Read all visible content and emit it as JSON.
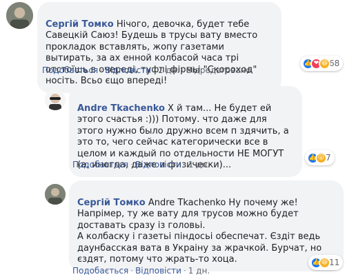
{
  "comments": [
    {
      "author": "Сергій Томко",
      "text": " Нічого, девочка, будет тебе Савецкій Саюз! Будешь в трусы вату вместо прокладок вставлять, жопу газетами вытирать, за ах        енной колбасой часа трі отстоїшь в очереді, туфлі фірмьі \"Скороход\" носіть. Всьо єщо впереді!",
      "actions": {
        "like": "Подобається",
        "reply": "Відповісти",
        "time": "1 дн.",
        "edited": "Відредаговано"
      },
      "reactions": {
        "icons": [
          "like-icon",
          "love-icon",
          "haha-icon"
        ],
        "count": "68"
      }
    },
    {
      "author": "Andre Tkachenko",
      "text": " Х   й там... Не будет ей этого счастья :))) Потому. что даже для этого нужно было дружно всем п   здячить, а это то, чего сейчас категорически все в целом и каждый по отдельности НЕ МОГУТ (а, иногда, даже и физически)...",
      "actions": {
        "like": "Подобається",
        "reply": "Відповісти",
        "time": "1 дн."
      },
      "reactions": {
        "icons": [
          "like-icon",
          "wow-icon"
        ],
        "count": "7"
      }
    },
    {
      "author": "Сергій Томко",
      "text": " Andre Tkachenko Ну почему же! Напрімер, ту же вату для трусов можно будет доставать сразу із головьі.\nА колбаску і газетьі піндосьі обеспечат. Єздіт ведь даунбасская вата в Украіну за жрачкой. Бурчат, но єздят, потому что жрать-то хоца.",
      "actions": {
        "like": "Подобається",
        "reply": "Відповісти",
        "time": "1 дн."
      },
      "reactions": {
        "icons": [
          "like-icon",
          "haha-icon"
        ],
        "count": "11"
      }
    }
  ],
  "colors": {
    "link": "#385898",
    "bubble": "#f2f3f5",
    "like": "#1877f2",
    "love": "#f33e58",
    "haha": "#f7b125"
  }
}
